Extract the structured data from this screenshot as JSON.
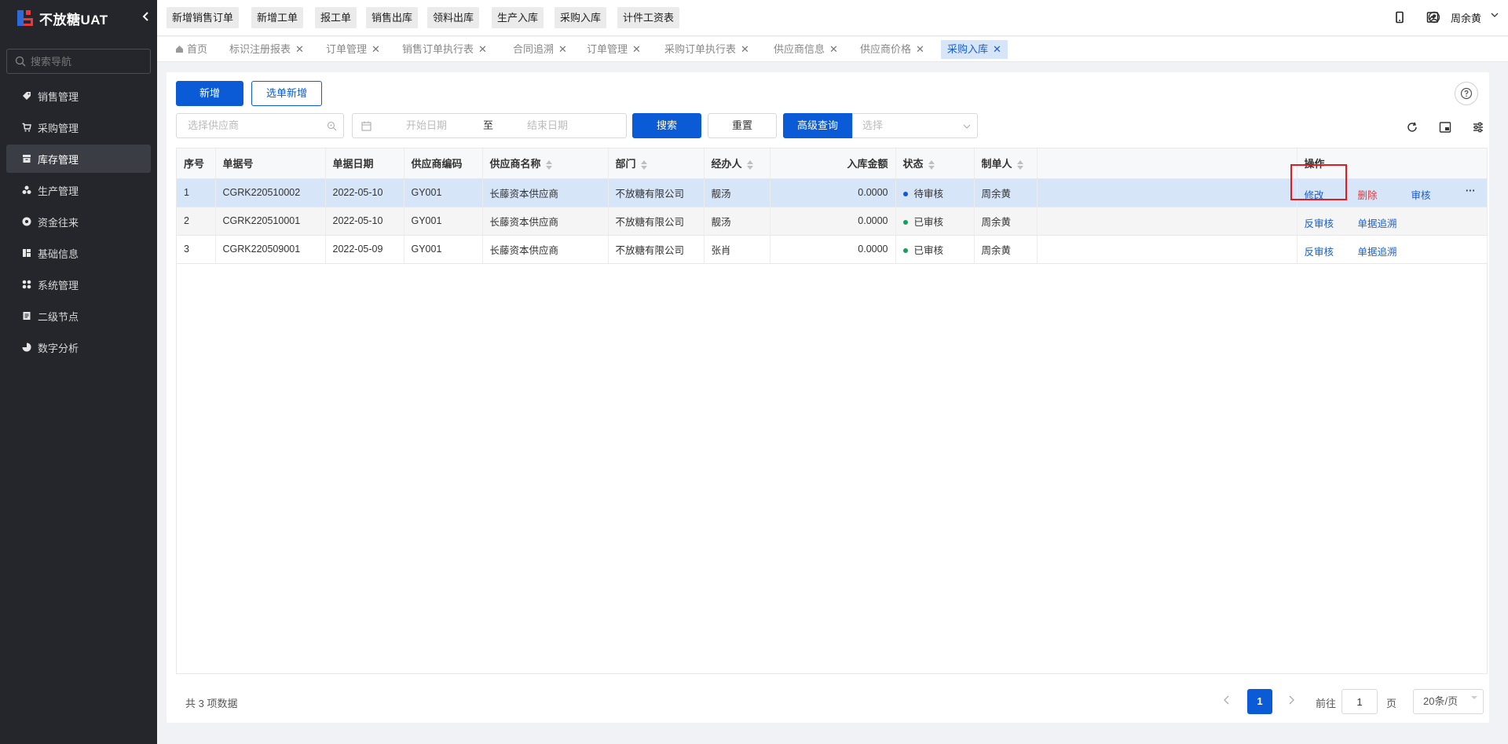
{
  "app": {
    "title": "不放糖UAT"
  },
  "sidebar": {
    "search_placeholder": "搜索导航",
    "items": [
      {
        "label": "销售管理",
        "icon": "tag-icon"
      },
      {
        "label": "采购管理",
        "icon": "cart-icon"
      },
      {
        "label": "库存管理",
        "icon": "warehouse-icon",
        "active": true
      },
      {
        "label": "生产管理",
        "icon": "production-icon"
      },
      {
        "label": "资金往来",
        "icon": "funds-icon"
      },
      {
        "label": "基础信息",
        "icon": "basic-info-icon"
      },
      {
        "label": "系统管理",
        "icon": "system-icon"
      },
      {
        "label": "二级节点",
        "icon": "doc-icon"
      },
      {
        "label": "数字分析",
        "icon": "pie-chart-icon"
      }
    ]
  },
  "topbar": {
    "quick_buttons": [
      "新增销售订单",
      "新增工单",
      "报工单",
      "销售出库",
      "领料出库",
      "生产入库",
      "采购入库",
      "计件工资表"
    ],
    "user_name": "周余黄"
  },
  "tabs": [
    {
      "label": "首页",
      "closable": false
    },
    {
      "label": "标识注册报表",
      "closable": true
    },
    {
      "label": "订单管理",
      "closable": true
    },
    {
      "label": "销售订单执行表",
      "closable": true
    },
    {
      "label": "合同追溯",
      "closable": true
    },
    {
      "label": "订单管理",
      "closable": true
    },
    {
      "label": "采购订单执行表",
      "closable": true
    },
    {
      "label": "供应商信息",
      "closable": true
    },
    {
      "label": "供应商价格",
      "closable": true
    },
    {
      "label": "采购入库",
      "closable": true,
      "active": true
    }
  ],
  "toolbar": {
    "add_label": "新增",
    "select_add_label": "选单新增",
    "supplier_placeholder": "选择供应商",
    "start_date_placeholder": "开始日期",
    "date_separator": "至",
    "end_date_placeholder": "结束日期",
    "search_label": "搜索",
    "reset_label": "重置",
    "advanced_label": "高级查询",
    "advanced_select_placeholder": "选择"
  },
  "table": {
    "columns": [
      "序号",
      "单据号",
      "单据日期",
      "供应商编码",
      "供应商名称",
      "部门",
      "经办人",
      "入库金额",
      "状态",
      "制单人",
      "",
      "操作"
    ],
    "rows": [
      {
        "idx": "1",
        "doc_no": "CGRK220510002",
        "date": "2022-05-10",
        "supplier_code": "GY001",
        "supplier_name": "长藤资本供应商",
        "dept": "不放糖有限公司",
        "handler": "靓汤",
        "amount": "0.0000",
        "status": "待审核",
        "status_color": "#0b5bd7",
        "creator": "周余黄",
        "actions": [
          "修改",
          "删除",
          "审核"
        ],
        "more": "···"
      },
      {
        "idx": "2",
        "doc_no": "CGRK220510001",
        "date": "2022-05-10",
        "supplier_code": "GY001",
        "supplier_name": "长藤资本供应商",
        "dept": "不放糖有限公司",
        "handler": "靓汤",
        "amount": "0.0000",
        "status": "已审核",
        "status_color": "#13a05a",
        "creator": "周余黄",
        "actions": [
          "反审核",
          "单据追溯"
        ]
      },
      {
        "idx": "3",
        "doc_no": "CGRK220509001",
        "date": "2022-05-09",
        "supplier_code": "GY001",
        "supplier_name": "长藤资本供应商",
        "dept": "不放糖有限公司",
        "handler": "张肖",
        "amount": "0.0000",
        "status": "已审核",
        "status_color": "#13a05a",
        "creator": "周余黄",
        "actions": [
          "反审核",
          "单据追溯"
        ]
      }
    ]
  },
  "footer": {
    "total_text": "共 3 项数据",
    "current_page": "1",
    "goto_label": "前往",
    "goto_value": "1",
    "page_suffix": "页",
    "page_size": "20条/页"
  }
}
